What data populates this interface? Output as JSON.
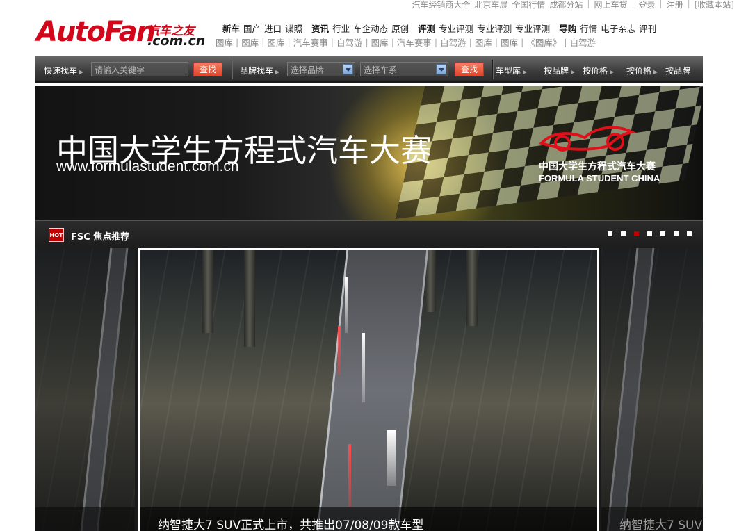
{
  "topbar": {
    "links": [
      "汽车经销商大全",
      "北京车展",
      "全国行情",
      "成都分站",
      "网上车贷",
      "登录",
      "注册",
      "[收藏本站]"
    ]
  },
  "logo": {
    "text_main": "AutoFan",
    "text_cn": "汽车之友",
    "text_domain": ".com.cn"
  },
  "nav": {
    "row1": [
      {
        "label": "新车",
        "bold": true
      },
      {
        "label": "国产"
      },
      {
        "label": "进口"
      },
      {
        "label": "谍照"
      },
      {
        "label": "资讯",
        "bold": true
      },
      {
        "label": "行业"
      },
      {
        "label": "车企动态"
      },
      {
        "label": "原创"
      },
      {
        "label": "评测",
        "bold": true
      },
      {
        "label": "专业评测"
      },
      {
        "label": "专业评测"
      },
      {
        "label": "专业评测"
      },
      {
        "label": "导购",
        "bold": true
      },
      {
        "label": "行情"
      },
      {
        "label": "电子杂志"
      },
      {
        "label": "评刊"
      }
    ],
    "row2": [
      "图库",
      "图库",
      "图库",
      "汽车赛事",
      "自驾游",
      "图库",
      "汽车赛事",
      "自驾游",
      "图库",
      "图库",
      "《图库》",
      "自驾游"
    ]
  },
  "searchbar": {
    "quick_label": "快速找车",
    "keyword_placeholder": "请输入关键字",
    "search_button": "查找",
    "brand_label": "品牌找车",
    "brand_select": "选择品牌",
    "series_select": "选择车系",
    "search_button2": "查找",
    "links": [
      "车型库",
      "按品牌",
      "按价格",
      "按价格",
      "按品牌"
    ]
  },
  "banner": {
    "title": "中国大学生方程式汽车大赛",
    "url": "www.formulastudent.com.cn",
    "logo_cn": "中国大学生方程式汽车大赛",
    "logo_en": "FORMULA STUDENT CHINA"
  },
  "focus": {
    "hot_badge": "HOT",
    "label": "FSC 焦点推荐",
    "dot_count": 7,
    "active_dot": 2
  },
  "carousel": {
    "center_caption": "纳智捷大7 SUV正式上市，共推出07/08/09款车型",
    "side_caption": "纳智捷大7 SUV"
  },
  "colors": {
    "brand_red": "#d3071c",
    "button_orange": "#e0452a",
    "dark_bar": "#2c2c2c"
  }
}
